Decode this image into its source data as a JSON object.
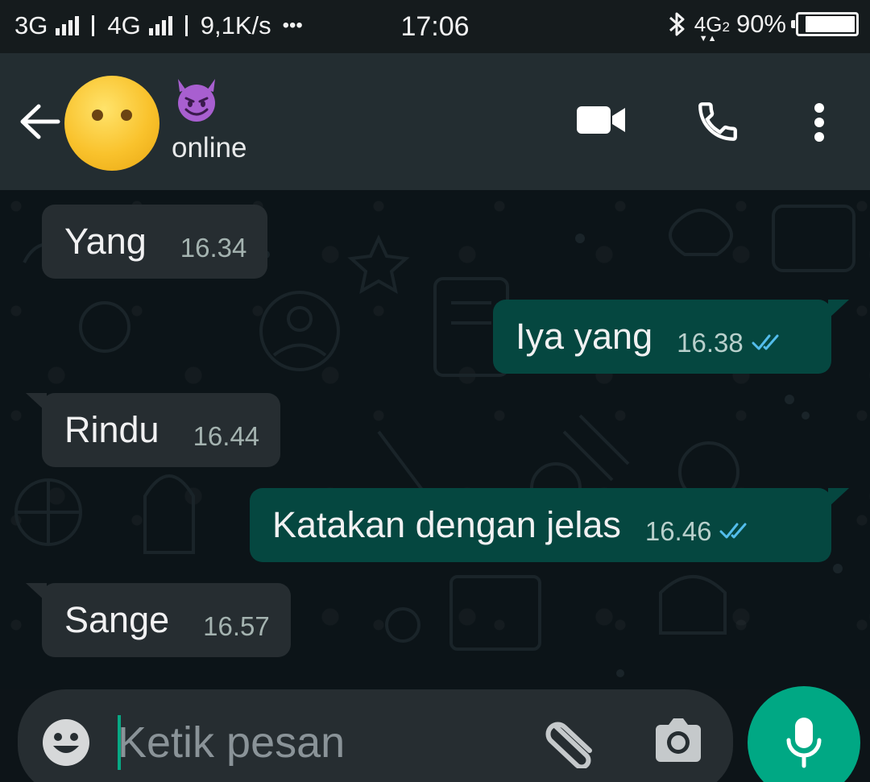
{
  "status_bar": {
    "net1": "3G",
    "net2": "4G",
    "speed": "9,1K/s",
    "more": "•••",
    "time": "17:06",
    "lte": "4G",
    "lte_sub": "2",
    "battery": "90%",
    "battery_level": 0.9
  },
  "header": {
    "contact_name_icon": "smiling-devil-emoji",
    "avatar_icon": "face-without-mouth-emoji",
    "status": "online",
    "icons": [
      "back-arrow-icon",
      "video-call-icon",
      "voice-call-icon",
      "more-options-icon"
    ]
  },
  "messages": [
    {
      "direction": "in",
      "text": "Yang",
      "time": "16.34"
    },
    {
      "direction": "out",
      "text": "Iya yang",
      "time": "16.38",
      "status": "read"
    },
    {
      "direction": "in",
      "text": "Rindu",
      "time": "16.44"
    },
    {
      "direction": "out",
      "text": "Katakan dengan jelas",
      "time": "16.46",
      "status": "read"
    },
    {
      "direction": "in",
      "text": "Sange",
      "time": "16.57"
    }
  ],
  "composer": {
    "placeholder": "Ketik pesan",
    "value": "",
    "icons": [
      "emoji-icon",
      "attach-icon",
      "camera-icon",
      "mic-icon"
    ]
  },
  "colors": {
    "incoming_bubble": "#262d31",
    "outgoing_bubble": "#054740",
    "accent": "#00a884",
    "read_ticks": "#53bdeb"
  }
}
